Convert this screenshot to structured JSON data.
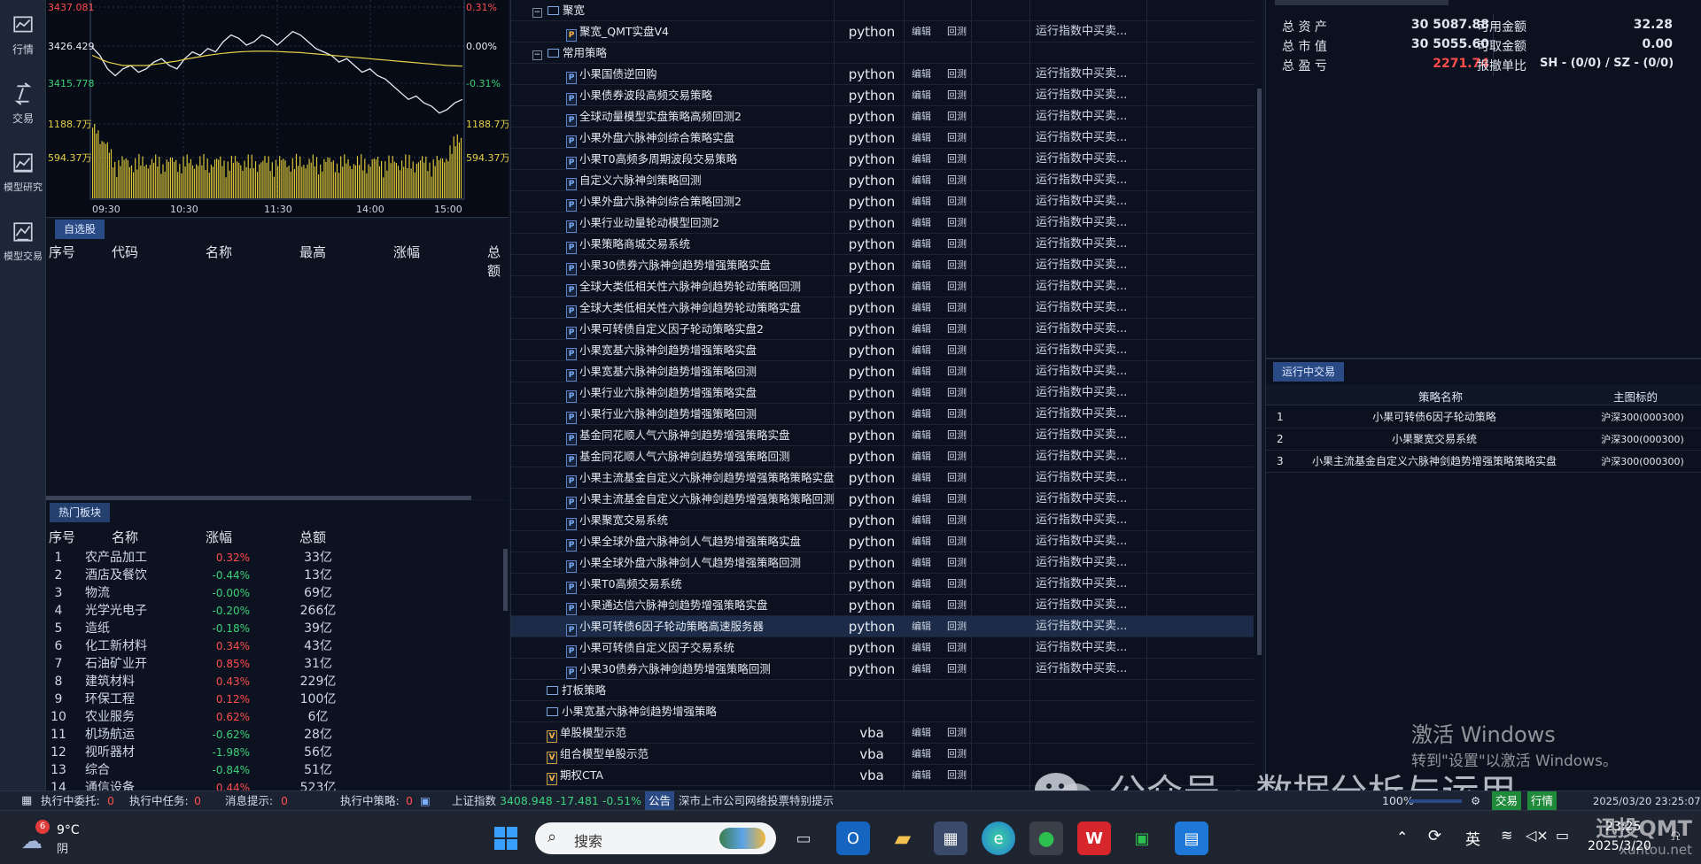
{
  "nav": [
    "行情",
    "交易",
    "模型研究",
    "模型交易"
  ],
  "chart": {
    "left_labels": [
      "3437.081",
      "3426.429",
      "3415.778",
      "1188.7万",
      "594.37万"
    ],
    "right_labels": [
      "0.31%",
      "0.00%",
      "-0.31%",
      "1188.7万",
      "594.37万"
    ],
    "times": [
      "09:30",
      "10:30",
      "11:30",
      "14:00",
      "15:00"
    ],
    "price": [
      3426.4,
      3424,
      3420,
      3418,
      3420,
      3421,
      3419,
      3420,
      3422,
      3423,
      3421,
      3420,
      3423,
      3425,
      3424,
      3426,
      3425,
      3428,
      3430,
      3429,
      3427,
      3428,
      3430,
      3429,
      3427,
      3429,
      3431,
      3430,
      3428,
      3426,
      3425,
      3424,
      3422,
      3423,
      3421,
      3419,
      3420,
      3418,
      3417,
      3415,
      3413,
      3411,
      3412,
      3410,
      3409,
      3407,
      3408,
      3410,
      3411
    ],
    "avg": [
      3424,
      3423,
      3422,
      3421.5,
      3421,
      3421,
      3421,
      3421,
      3421.3,
      3421.6,
      3422,
      3422.3,
      3422.8,
      3423.2,
      3423.6,
      3424,
      3424.3,
      3424.6,
      3424.8,
      3425,
      3425.1,
      3425.2,
      3425.2,
      3425.2,
      3425.1,
      3425,
      3424.9,
      3424.8,
      3424.6,
      3424.4,
      3424.2,
      3424,
      3423.8,
      3423.6,
      3423.4,
      3423.2,
      3423,
      3422.8,
      3422.6,
      3422.4,
      3422.2,
      3422,
      3421.8,
      3421.6,
      3421.4,
      3421.2,
      3421,
      3420.9,
      3420.8
    ],
    "price_range": [
      3415.778,
      3437.081
    ],
    "volume_range": [
      0,
      1188.7
    ]
  },
  "watchlist": {
    "tab": "自选股",
    "headers": [
      "序号",
      "代码",
      "名称",
      "最高",
      "涨幅",
      "总额"
    ]
  },
  "hot": {
    "tab": "热门板块",
    "headers": [
      "序号",
      "名称",
      "涨幅",
      "总额"
    ],
    "rows": [
      [
        "1",
        "农产品加工",
        "0.32%",
        "33亿"
      ],
      [
        "2",
        "酒店及餐饮",
        "-0.44%",
        "13亿"
      ],
      [
        "3",
        "物流",
        "-0.00%",
        "69亿"
      ],
      [
        "4",
        "光学光电子",
        "-0.20%",
        "266亿"
      ],
      [
        "5",
        "造纸",
        "-0.18%",
        "39亿"
      ],
      [
        "6",
        "化工新材料",
        "0.34%",
        "43亿"
      ],
      [
        "7",
        "石油矿业开",
        "0.85%",
        "31亿"
      ],
      [
        "8",
        "建筑材料",
        "0.43%",
        "229亿"
      ],
      [
        "9",
        "环保工程",
        "0.12%",
        "100亿"
      ],
      [
        "10",
        "农业服务",
        "0.62%",
        "6亿"
      ],
      [
        "11",
        "机场航运",
        "-0.62%",
        "28亿"
      ],
      [
        "12",
        "视听器材",
        "-1.98%",
        "56亿"
      ],
      [
        "13",
        "综合",
        "-0.84%",
        "51亿"
      ],
      [
        "14",
        "通信设备",
        "0.44%",
        "523亿"
      ]
    ]
  },
  "strategies": {
    "group1": "聚宽",
    "group2": "常用策略",
    "edit": "编辑",
    "backtest": "回测",
    "desc": "运行指数中买卖...",
    "items": [
      {
        "name": "聚宽_QMT实盘V4",
        "lang": "python",
        "indent": 2,
        "kind": "jq"
      },
      {
        "name": "小果国债逆回购",
        "lang": "python",
        "indent": 2,
        "kind": "p"
      },
      {
        "name": "小果债券波段高频交易策略",
        "lang": "python",
        "indent": 2,
        "kind": "p"
      },
      {
        "name": "全球动量模型实盘策略高频回测2",
        "lang": "python",
        "indent": 2,
        "kind": "p"
      },
      {
        "name": "小果外盘六脉神剑综合策略实盘",
        "lang": "python",
        "indent": 2,
        "kind": "p"
      },
      {
        "name": "小果T0高频多周期波段交易策略",
        "lang": "python",
        "indent": 2,
        "kind": "p"
      },
      {
        "name": "自定义六脉神剑策略回测",
        "lang": "python",
        "indent": 2,
        "kind": "p"
      },
      {
        "name": "小果外盘六脉神剑综合策略回测2",
        "lang": "python",
        "indent": 2,
        "kind": "p"
      },
      {
        "name": "小果行业动量轮动模型回测2",
        "lang": "python",
        "indent": 2,
        "kind": "p"
      },
      {
        "name": "小果策略商城交易系统",
        "lang": "python",
        "indent": 2,
        "kind": "p"
      },
      {
        "name": "小果30债券六脉神剑趋势增强策略实盘",
        "lang": "python",
        "indent": 2,
        "kind": "p"
      },
      {
        "name": "全球大类低相关性六脉神剑趋势轮动策略回测",
        "lang": "python",
        "indent": 2,
        "kind": "p"
      },
      {
        "name": "全球大类低相关性六脉神剑趋势轮动策略实盘",
        "lang": "python",
        "indent": 2,
        "kind": "p"
      },
      {
        "name": "小果可转债自定义因子轮动策略实盘2",
        "lang": "python",
        "indent": 2,
        "kind": "p"
      },
      {
        "name": "小果宽基六脉神剑趋势增强策略实盘",
        "lang": "python",
        "indent": 2,
        "kind": "p"
      },
      {
        "name": "小果宽基六脉神剑趋势增强策略回测",
        "lang": "python",
        "indent": 2,
        "kind": "p"
      },
      {
        "name": "小果行业六脉神剑趋势增强策略实盘",
        "lang": "python",
        "indent": 2,
        "kind": "p"
      },
      {
        "name": "小果行业六脉神剑趋势增强策略回测",
        "lang": "python",
        "indent": 2,
        "kind": "p"
      },
      {
        "name": "基金同花顺人气六脉神剑趋势增强策略实盘",
        "lang": "python",
        "indent": 2,
        "kind": "p"
      },
      {
        "name": "基金同花顺人气六脉神剑趋势增强策略回测",
        "lang": "python",
        "indent": 2,
        "kind": "p"
      },
      {
        "name": "小果主流基金自定义六脉神剑趋势增强策略策略实盘",
        "lang": "python",
        "indent": 2,
        "kind": "p"
      },
      {
        "name": "小果主流基金自定义六脉神剑趋势增强策略策略回测",
        "lang": "python",
        "indent": 2,
        "kind": "p"
      },
      {
        "name": "小果聚宽交易系统",
        "lang": "python",
        "indent": 2,
        "kind": "p"
      },
      {
        "name": "小果全球外盘六脉神剑人气趋势增强策略实盘",
        "lang": "python",
        "indent": 2,
        "kind": "p"
      },
      {
        "name": "小果全球外盘六脉神剑人气趋势增强策略回测",
        "lang": "python",
        "indent": 2,
        "kind": "p"
      },
      {
        "name": "小果T0高频交易系统",
        "lang": "python",
        "indent": 2,
        "kind": "p"
      },
      {
        "name": "小果通达信六脉神剑趋势增强策略实盘",
        "lang": "python",
        "indent": 2,
        "kind": "p"
      },
      {
        "name": "小果可转债6因子轮动策略高速服务器",
        "lang": "python",
        "indent": 2,
        "kind": "p",
        "selected": true
      },
      {
        "name": "小果可转债自定义因子交易系统",
        "lang": "python",
        "indent": 2,
        "kind": "p"
      },
      {
        "name": "小果30债券六脉神剑趋势增强策略回测",
        "lang": "python",
        "indent": 2,
        "kind": "p"
      },
      {
        "name": "打板策略",
        "lang": "",
        "indent": 1,
        "kind": "folder"
      },
      {
        "name": "小果宽基六脉神剑趋势增强策略",
        "lang": "",
        "indent": 1,
        "kind": "folder"
      },
      {
        "name": "单股模型示范",
        "lang": "vba",
        "indent": 1,
        "kind": "v"
      },
      {
        "name": "组合模型单股示范",
        "lang": "vba",
        "indent": 1,
        "kind": "v"
      },
      {
        "name": "期权CTA",
        "lang": "vba",
        "indent": 1,
        "kind": "v"
      }
    ]
  },
  "account": {
    "labels_left": [
      "总 资 产",
      "总 市 值",
      "总 盈 亏"
    ],
    "values_left": [
      "30 5087.88",
      "30 5055.60",
      "2271.74"
    ],
    "labels_right": [
      "可用金额",
      "可取金额",
      "报撤单比"
    ],
    "values_right": [
      "32.28",
      "0.00",
      "SH - (0/0) / SZ - (0/0)"
    ]
  },
  "running": {
    "tab": "运行中交易",
    "headers": [
      "策略名称",
      "主图标的"
    ],
    "rows": [
      [
        "1",
        "小果可转债6因子轮动策略",
        "沪深300(000300)"
      ],
      [
        "2",
        "小果聚宽交易系统",
        "沪深300(000300)"
      ],
      [
        "3",
        "小果主流基金自定义六脉神剑趋势增强策略策略实盘",
        "沪深300(000300)"
      ]
    ]
  },
  "status": {
    "items": [
      "执行中委托:",
      "0",
      "执行中任务:",
      "0",
      "消息提示:",
      "0",
      "执行中策略:",
      "0"
    ],
    "index_name": "上证指数",
    "index_vals": "3408.948  -17.481  -0.51%",
    "notice_tag": "公告",
    "notice": "深市上市公司网络投票特别提示",
    "right": [
      "100%",
      "交易",
      "行情",
      "2025/03/20 23:25:07"
    ]
  },
  "windows_watermark": [
    "激活 Windows",
    "转到\"设置\"以激活 Windows。"
  ],
  "wechat_watermark": "公众号 · 数据分析与运用",
  "brand_watermark": [
    "迅投QMT",
    "xuntou.net"
  ],
  "taskbar": {
    "weather_temp": "9°C",
    "weather_desc": "阴",
    "weather_badge": "6",
    "search": "搜索",
    "lang": "英",
    "time": "23:25",
    "date": "2025/3/20"
  }
}
